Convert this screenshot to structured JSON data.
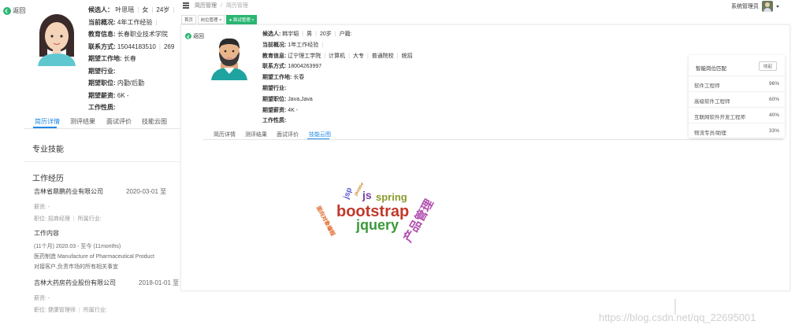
{
  "left": {
    "back_label": "返回",
    "candidate_label": "候选人：",
    "candidate_name": "叶思瑶",
    "candidate_gender": "女",
    "candidate_age": "24岁",
    "status_label": "当前概况:",
    "status_value": "4年工作经验",
    "edu_label": "教育信息:",
    "edu_value": "长春职业技术学院",
    "contact_label": "联系方式:",
    "contact_value": "15044183510",
    "contact_extra": "269",
    "place_label": "期望工作地:",
    "place_value": "长春",
    "industry_label": "期望行业:",
    "position_label": "期望职位:",
    "position_value": "内勤/后勤",
    "salary_label": "期望薪资:",
    "salary_value": "6K -",
    "worktype_label": "工作性质:",
    "tabs": [
      "简历详情",
      "测评结果",
      "面试评价",
      "技能云图"
    ],
    "skills_title": "专业技能",
    "experience_title": "工作经历",
    "jobs": [
      {
        "company": "吉林省鼎鹏药业有限公司",
        "date": "2020-03-01 至",
        "salary": "薪资: -",
        "role": "职位: 招商经理",
        "industry": "所属行业:"
      },
      {
        "company": "吉林大药房药业股份有限公司",
        "date": "2018-01-01 至",
        "salary": "薪资: -",
        "role": "职位: 健康管理师",
        "industry": "所属行业:"
      }
    ],
    "work_content_title": "工作内容",
    "work_period": "(11个月)   2020.03 - 至今 (11months)",
    "work_line1": "医药制造   Manufacture of Pharmaceutical Product",
    "work_line2": "对接客户,负责市场的所有相关事宜"
  },
  "topbar": {
    "menu_icon": "hamburger-icon",
    "breadcrumb": [
      "简历管理",
      "/",
      "简历管理"
    ],
    "admin_name": "系统管理员",
    "dropdown_icon": "caret-down-icon"
  },
  "page_tabs": [
    "首页",
    "岗位管理",
    "● 面试管理"
  ],
  "panel": {
    "back_label": "返回",
    "candidate_label": "候选人:",
    "candidate_name": "韩宇韬",
    "candidate_gender": "男",
    "candidate_age": "20岁",
    "origin_label": "户籍:",
    "status_label": "当前概况:",
    "status_value": "1年工作经验",
    "edu_label": "教育信息:",
    "edu_values": [
      "辽宁理工学院",
      "计算机",
      "大专",
      "普通院校",
      "统招"
    ],
    "contact_label": "联系方式:",
    "contact_value": "18004263997",
    "place_label": "期望工作地:",
    "place_value": "长春",
    "industry_label": "期望行业:",
    "position_label": "期望职位:",
    "position_value": "Java,Java",
    "salary_label": "期望薪资:",
    "salary_value": "4K -",
    "worktype_label": "工作性质:",
    "tabs": [
      "简历详情",
      "测评结果",
      "面试评价",
      "技能云图"
    ],
    "active_tab": "技能云图"
  },
  "match": {
    "title": "智能岗位匹配",
    "collapse_label": "收起",
    "rows": [
      {
        "job": "软件工程师",
        "score": "96%"
      },
      {
        "job": "高级软件工程师",
        "score": "60%"
      },
      {
        "job": "互联网软件开发工程师",
        "score": "40%"
      },
      {
        "job": "物流专员/助理",
        "score": "33%"
      }
    ]
  },
  "wordcloud": {
    "words": [
      "bootstrap",
      "jquery",
      "spring",
      "js",
      "jsp",
      "javase",
      "产品管理",
      "面向对象编程"
    ],
    "colors": {
      "bootstrap": "#c0392b",
      "jquery": "#3a9a3a",
      "spring": "#8a9a2a",
      "js": "#7a3fa8",
      "jsp": "#5a5ad0",
      "javase": "#d08a2a",
      "产品管理": "#b24fb0",
      "面向对象编程": "#e0672a"
    }
  },
  "watermark": "https://blog.csdn.net/qq_22695001",
  "colors": {
    "accent": "#1e88e5",
    "tab_green": "#2bb673",
    "back_green": "#2bb673"
  }
}
